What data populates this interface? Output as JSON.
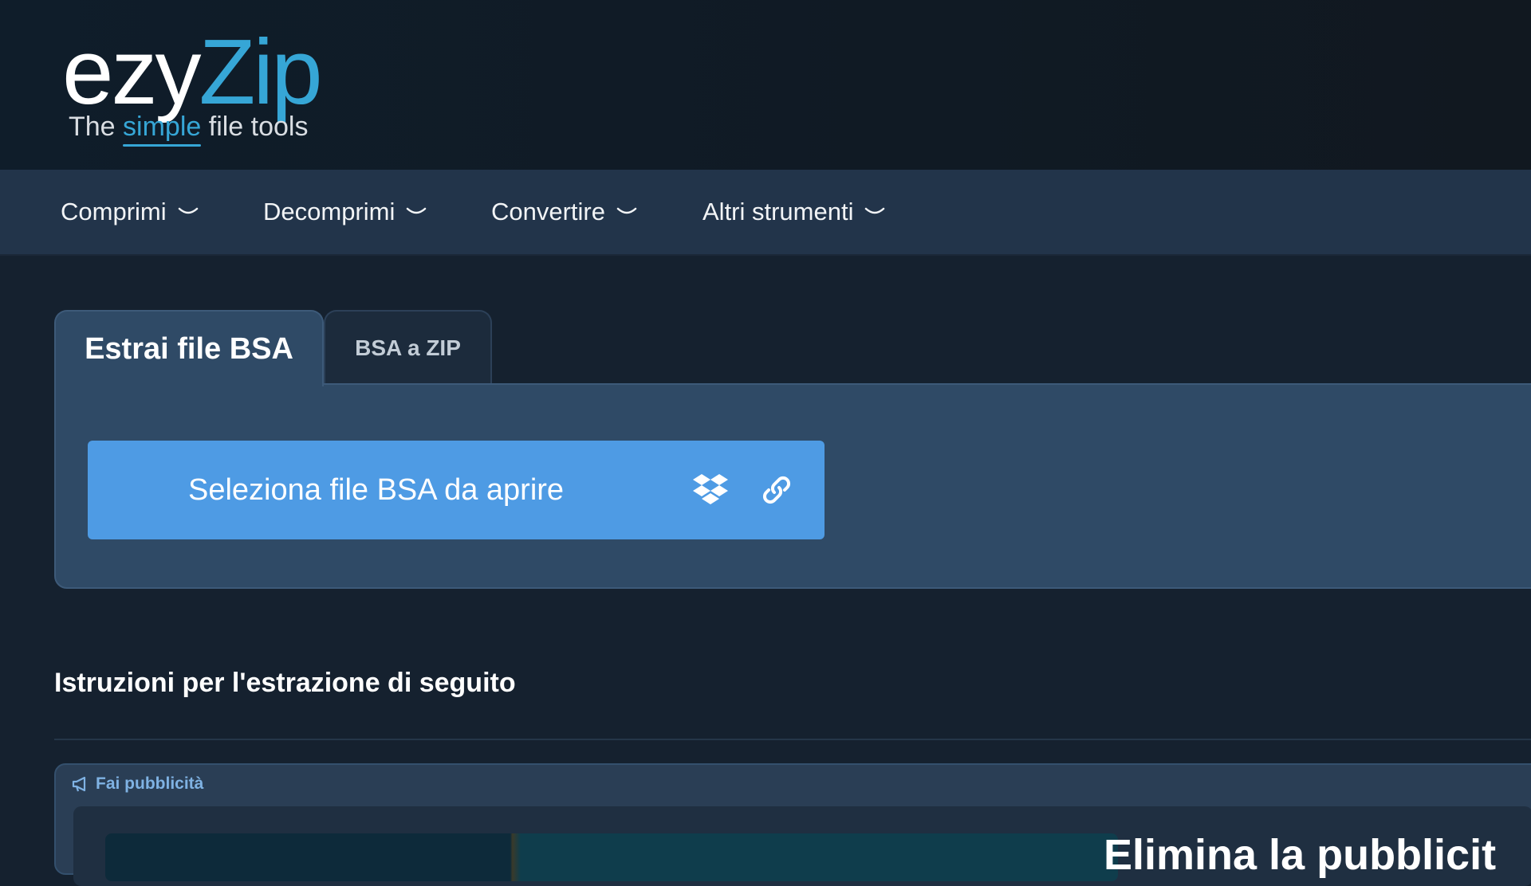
{
  "logo": {
    "word_part1": "ezy",
    "word_part2": "Zip",
    "tagline_before": "The ",
    "tagline_highlight": "simple",
    "tagline_after": " file tools"
  },
  "nav": {
    "items": [
      {
        "label": "Comprimi",
        "icon": "chevron-down-icon"
      },
      {
        "label": "Decomprimi",
        "icon": "chevron-down-icon"
      },
      {
        "label": "Convertire",
        "icon": "chevron-down-icon"
      },
      {
        "label": "Altri strumenti",
        "icon": "chevron-down-icon"
      }
    ]
  },
  "tabs": [
    {
      "label": "Estrai file BSA",
      "active": true
    },
    {
      "label": "BSA a ZIP",
      "active": false
    }
  ],
  "upload": {
    "label": "Seleziona file BSA da aprire",
    "icons": [
      "dropbox-icon",
      "link-icon"
    ]
  },
  "instructions_heading": "Istruzioni per l'estrazione di seguito",
  "ad": {
    "label": "Fai pubblicità",
    "icon": "megaphone-icon",
    "heading_partial": "Elimina la pubblicit"
  },
  "colors": {
    "accent": "#36a6d6",
    "button": "#4e9be4",
    "nav_bg": "#22344a",
    "panel_bg": "#2f4a66",
    "page_bg": "#15212f"
  }
}
